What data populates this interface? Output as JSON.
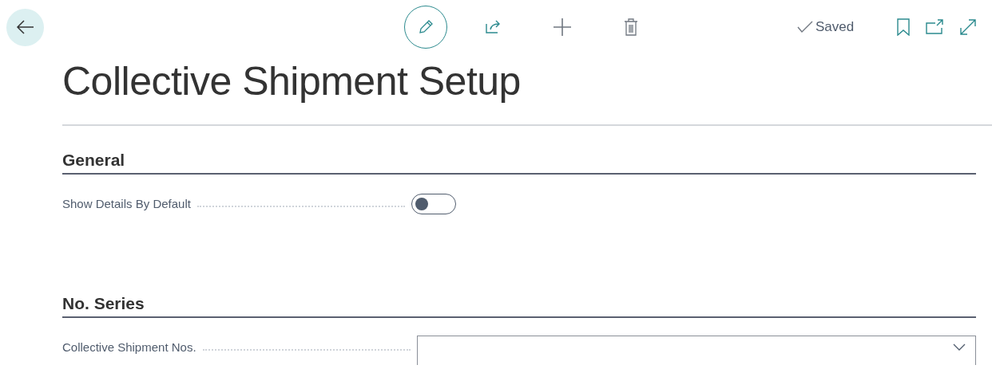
{
  "status": "Saved",
  "title": "Collective Shipment Setup",
  "sections": [
    {
      "heading": "General",
      "fields": [
        {
          "kind": "toggle",
          "label": "Show Details By Default",
          "on": false
        }
      ]
    },
    {
      "heading": "No. Series",
      "fields": [
        {
          "kind": "select",
          "label": "Collective Shipment Nos."
        }
      ]
    }
  ]
}
